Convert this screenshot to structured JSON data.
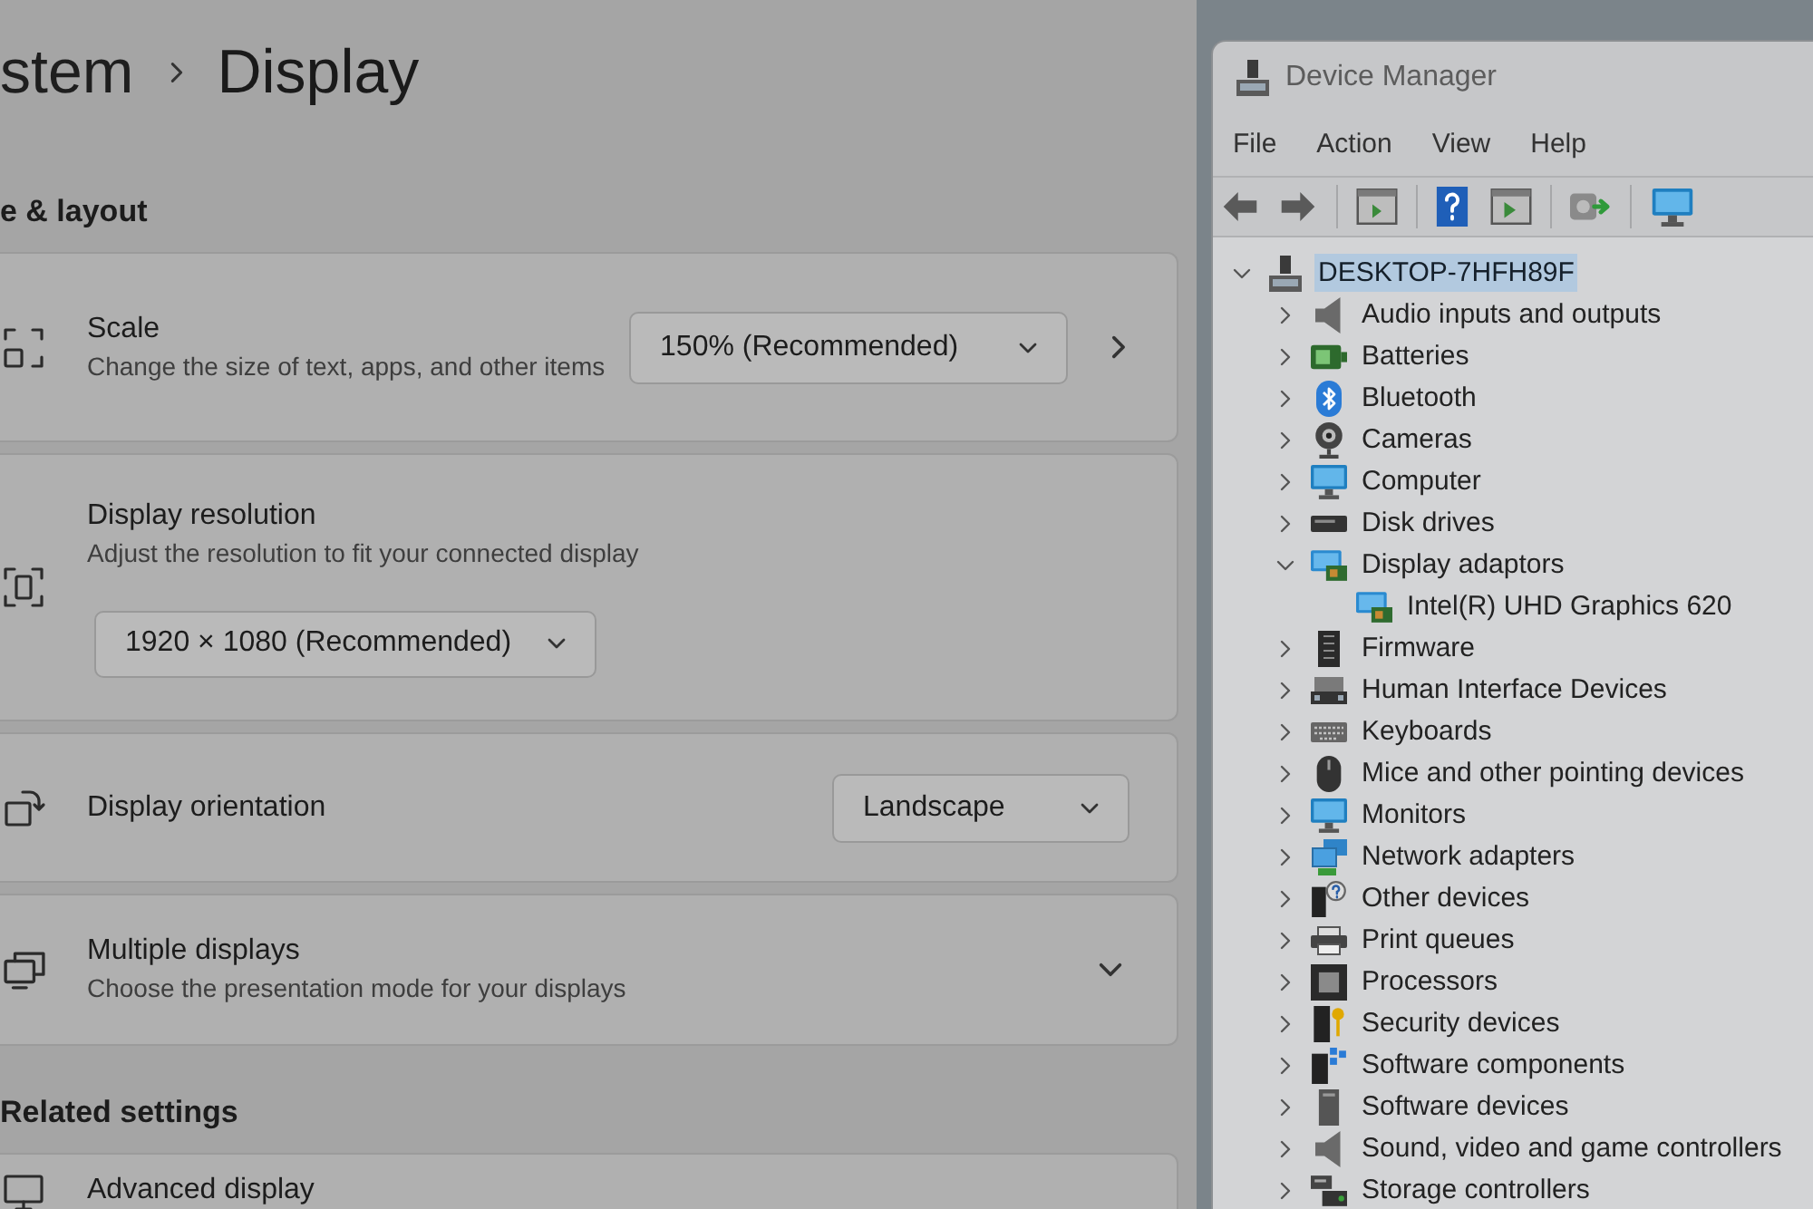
{
  "settings": {
    "breadcrumb": {
      "parent": "stem",
      "current": "Display"
    },
    "sections": [
      {
        "heading": "e & layout",
        "cards": [
          {
            "kind": "select-link",
            "title": "Scale",
            "description": "Change the size of text, apps, and other items",
            "value": "150% (Recommended)"
          },
          {
            "kind": "select-below",
            "title": "Display resolution",
            "description": "Adjust the resolution to fit your connected display",
            "value": "1920 × 1080 (Recommended)"
          },
          {
            "kind": "select",
            "title": "Display orientation",
            "value": "Landscape"
          },
          {
            "kind": "expander",
            "title": "Multiple displays",
            "description": "Choose the presentation mode for your displays",
            "expanded": false
          }
        ]
      },
      {
        "heading": "Related settings",
        "cards": [
          {
            "kind": "link",
            "title": "Advanced display"
          }
        ]
      }
    ]
  },
  "device_manager": {
    "title": "Device Manager",
    "menu": [
      "File",
      "Action",
      "View",
      "Help"
    ],
    "tree": [
      {
        "label": "DESKTOP-7HFH89F",
        "expanded": true,
        "selected": true,
        "children": [
          {
            "label": "Audio inputs and outputs",
            "expanded": false,
            "selected": false
          },
          {
            "label": "Batteries",
            "expanded": false,
            "selected": false
          },
          {
            "label": "Bluetooth",
            "expanded": false,
            "selected": false
          },
          {
            "label": "Cameras",
            "expanded": false,
            "selected": false
          },
          {
            "label": "Computer",
            "expanded": false,
            "selected": false
          },
          {
            "label": "Disk drives",
            "expanded": false,
            "selected": false
          },
          {
            "label": "Display adaptors",
            "expanded": true,
            "selected": false,
            "children": [
              {
                "label": "Intel(R) UHD Graphics 620",
                "selected": false
              }
            ]
          },
          {
            "label": "Firmware",
            "expanded": false,
            "selected": false
          },
          {
            "label": "Human Interface Devices",
            "expanded": false,
            "selected": false
          },
          {
            "label": "Keyboards",
            "expanded": false,
            "selected": false
          },
          {
            "label": "Mice and other pointing devices",
            "expanded": false,
            "selected": false
          },
          {
            "label": "Monitors",
            "expanded": false,
            "selected": false
          },
          {
            "label": "Network adapters",
            "expanded": false,
            "selected": false
          },
          {
            "label": "Other devices",
            "expanded": false,
            "selected": false
          },
          {
            "label": "Print queues",
            "expanded": false,
            "selected": false
          },
          {
            "label": "Processors",
            "expanded": false,
            "selected": false
          },
          {
            "label": "Security devices",
            "expanded": false,
            "selected": false
          },
          {
            "label": "Software components",
            "expanded": false,
            "selected": false
          },
          {
            "label": "Software devices",
            "expanded": false,
            "selected": false
          },
          {
            "label": "Sound, video and game controllers",
            "expanded": false,
            "selected": false
          },
          {
            "label": "Storage controllers",
            "expanded": false,
            "selected": false
          }
        ]
      }
    ]
  }
}
